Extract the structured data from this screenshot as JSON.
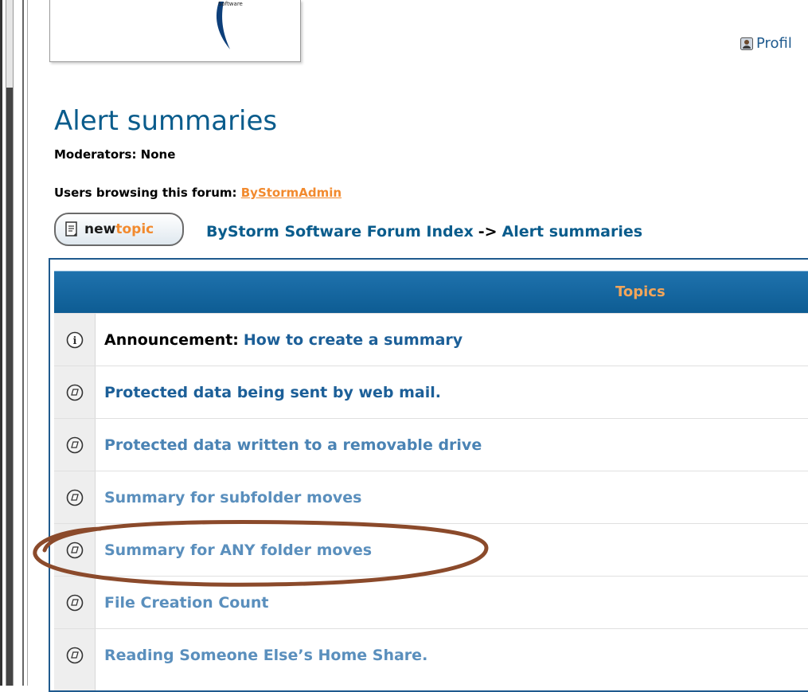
{
  "logo": {
    "text": "Software"
  },
  "profile": {
    "label": "Profil",
    "icon": "user-profile-icon"
  },
  "forum": {
    "title": "Alert summaries",
    "moderators": "Moderators: None",
    "users_browsing_label": "Users browsing this forum: ",
    "users_browsing_user": "ByStormAdmin"
  },
  "new_topic": {
    "new": "new",
    "topic": "topic",
    "icon": "new-topic-icon"
  },
  "breadcrumb": {
    "index": "ByStorm Software Forum Index",
    "separator": "->",
    "current": "Alert summaries"
  },
  "table": {
    "header": "Topics",
    "rows": [
      {
        "type": "announcement",
        "label": "Announcement:",
        "title": "How to create a summary",
        "icon": "info-icon"
      },
      {
        "type": "topic",
        "title": "Protected data being sent by web mail.",
        "icon": "topic-icon"
      },
      {
        "type": "topic",
        "title": "Protected data written to a removable drive",
        "icon": "topic-icon"
      },
      {
        "type": "topic",
        "title": "Summary for subfolder moves",
        "icon": "topic-icon"
      },
      {
        "type": "topic",
        "title": "Summary for ANY folder moves",
        "icon": "topic-icon"
      },
      {
        "type": "topic",
        "title": "File Creation Count",
        "icon": "topic-icon"
      },
      {
        "type": "topic",
        "title": "Reading Someone Else’s Home Share.",
        "icon": "topic-icon"
      }
    ]
  },
  "colors": {
    "title_blue": "#0a5c8c",
    "header_blue": "#1f72ad",
    "header_text": "#f2a55a",
    "user_link": "#f28a2e",
    "highlight_ellipse": "#8b4a2b"
  }
}
